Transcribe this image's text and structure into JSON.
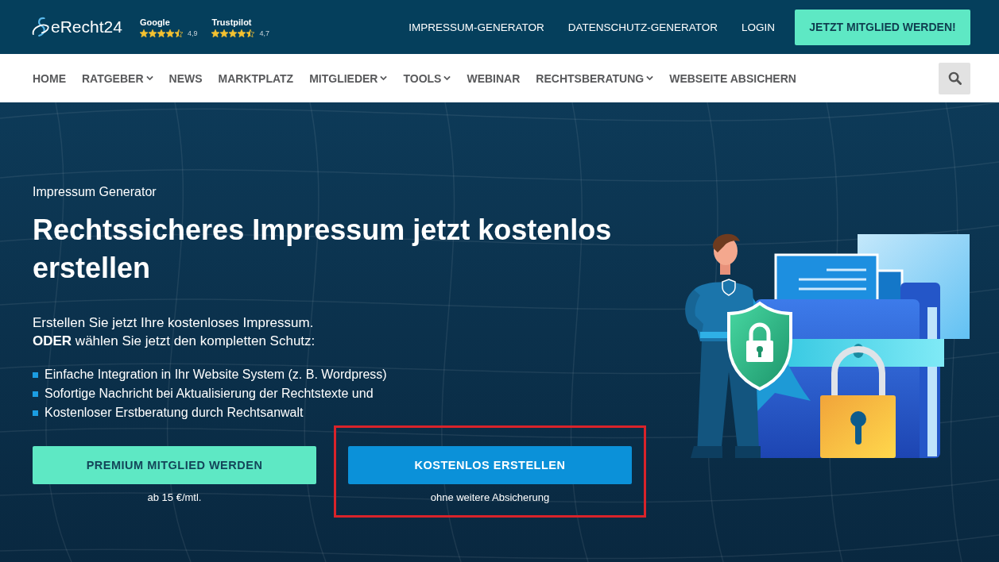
{
  "header": {
    "logo": {
      "text": "eRecht24"
    },
    "ratings": [
      {
        "source": "Google",
        "stars": 4.5,
        "score": "4,9"
      },
      {
        "source": "Trustpilot",
        "stars": 4.5,
        "score": "4,7"
      }
    ],
    "links": [
      "IMPRESSUM-GENERATOR",
      "DATENSCHUTZ-GENERATOR",
      "LOGIN"
    ],
    "cta": "JETZT MITGLIED WERDEN!"
  },
  "nav": {
    "items": [
      {
        "label": "HOME",
        "has_menu": false
      },
      {
        "label": "RATGEBER",
        "has_menu": true
      },
      {
        "label": "NEWS",
        "has_menu": false
      },
      {
        "label": "MARKTPLATZ",
        "has_menu": false
      },
      {
        "label": "MITGLIEDER",
        "has_menu": true
      },
      {
        "label": "TOOLS",
        "has_menu": true
      },
      {
        "label": "WEBINAR",
        "has_menu": false
      },
      {
        "label": "RECHTSBERATUNG",
        "has_menu": true
      },
      {
        "label": "WEBSEITE ABSICHERN",
        "has_menu": false
      }
    ]
  },
  "hero": {
    "eyebrow": "Impressum Generator",
    "title": "Rechtssicheres Impressum jetzt kostenlos erstellen",
    "intro": [
      "Erstellen Sie jetzt Ihre kostenloses Impressum.",
      "**ODER** wählen Sie jetzt den kompletten Schutz:"
    ],
    "bullets": [
      "Einfache Integration in Ihr Website System (z. B. Wordpress)",
      "Sofortige Nachricht bei Aktualisierung der Rechtstexte und",
      "Kostenloser Erstberatung durch Rechtsanwalt"
    ],
    "actions": [
      {
        "kind": "primary",
        "label": "PREMIUM MITGLIED WERDEN",
        "note": "ab 15 €/mtl.",
        "highlighted": false
      },
      {
        "kind": "secondary",
        "label": "KOSTENLOS ERSTELLEN",
        "note": "ohne weitere Absicherung",
        "highlighted": true
      }
    ]
  }
}
